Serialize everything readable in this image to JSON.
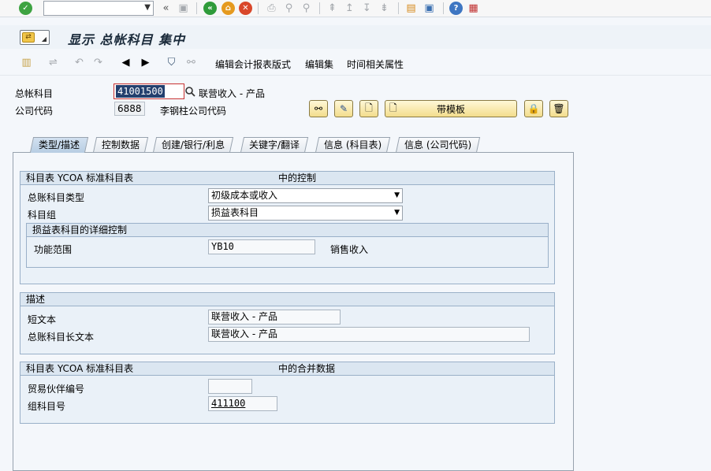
{
  "system_toolbar": {
    "icons": [
      "enter-icon",
      "command-dropdown-icon",
      "back-nav-icon",
      "save-icon",
      "back-icon",
      "exit-icon",
      "cancel-icon",
      "print-icon",
      "find-icon",
      "find-next-icon",
      "first-page-icon",
      "previous-page-icon",
      "next-page-icon",
      "last-page-icon",
      "create-session-icon",
      "shortcut-icon",
      "help-icon",
      "layout-icon"
    ],
    "command_value": ""
  },
  "title": "显示 总帐科目 集中",
  "app_toolbar": {
    "edit_report_layout": "编辑会计报表版式",
    "edit_sets": "编辑集",
    "time_attributes": "时间相关属性"
  },
  "header": {
    "gl_account_label": "总帐科目",
    "gl_account_value": "41001500",
    "gl_account_desc": "联营收入 - 产品",
    "company_code_label": "公司代码",
    "company_code_value": "6888",
    "company_code_desc": "李钢柱公司代码",
    "with_template_label": "带模板"
  },
  "tabs": [
    {
      "label": "类型/描述",
      "active": true
    },
    {
      "label": "控制数据",
      "active": false
    },
    {
      "label": "创建/银行/利息",
      "active": false
    },
    {
      "label": "关键字/翻译",
      "active": false
    },
    {
      "label": "信息 (科目表)",
      "active": false
    },
    {
      "label": "信息 (公司代码)",
      "active": false
    }
  ],
  "control_group": {
    "title": "科目表 YCOA 标准科目表",
    "title_right": "中的控制",
    "account_type_label": "总账科目类型",
    "account_type_value": "初级成本或收入",
    "account_group_label": "科目组",
    "account_group_value": "损益表科目",
    "pl_detail": {
      "title": "损益表科目的详细控制",
      "functional_area_label": "功能范围",
      "functional_area_value": "YB10",
      "functional_area_desc": "销售收入"
    }
  },
  "description_group": {
    "title": "描述",
    "short_text_label": "短文本",
    "short_text_value": "联营收入 - 产品",
    "long_text_label": "总账科目长文本",
    "long_text_value": "联营收入 - 产品"
  },
  "consolidation_group": {
    "title": "科目表 YCOA 标准科目表",
    "title_right": "中的合并数据",
    "trading_partner_label": "贸易伙伴编号",
    "trading_partner_value": "",
    "group_account_label": "组科目号",
    "group_account_value": "411100"
  },
  "colors": {
    "accent": "#24406e",
    "tab_active": "#c6d8ea",
    "group_bg": "#eaf1f8"
  }
}
